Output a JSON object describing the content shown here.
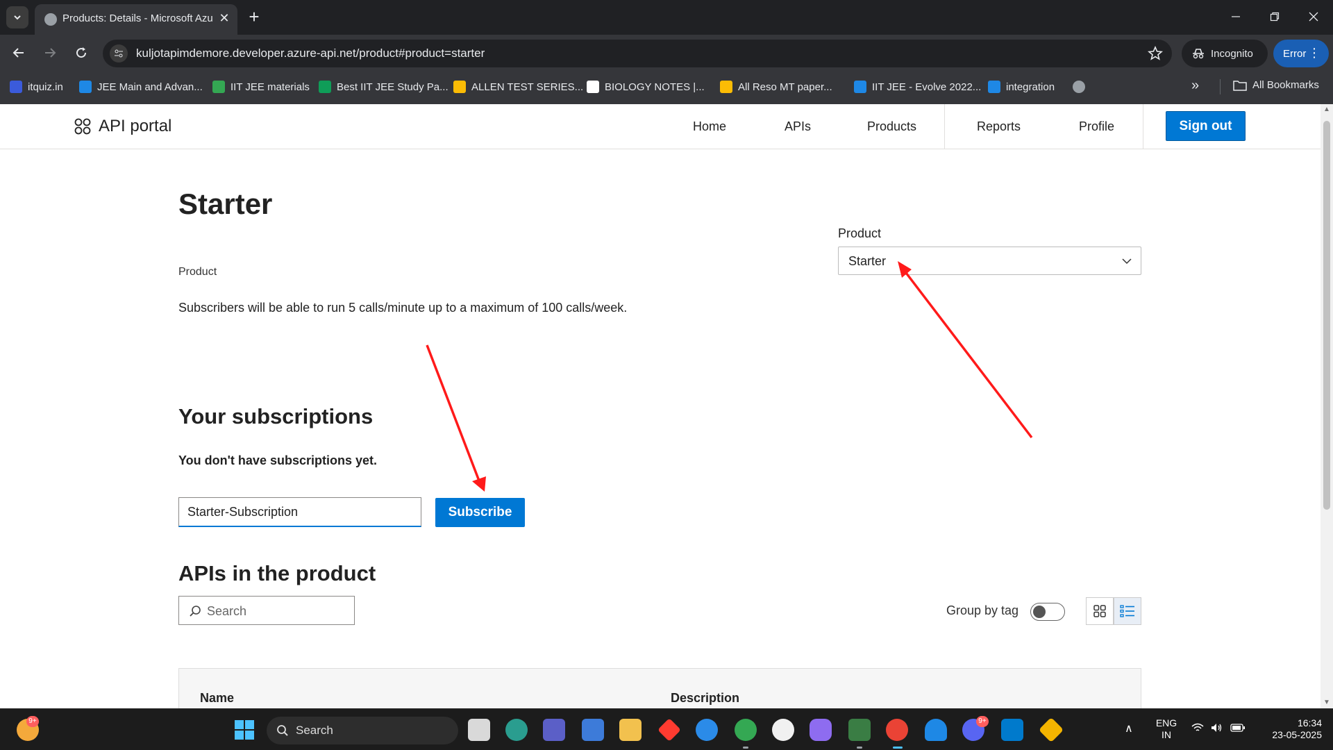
{
  "browser": {
    "tab_title": "Products: Details - Microsoft Azure",
    "url": "kuljotapimdemore.developer.azure-api.net/product#product=starter",
    "incognito_label": "Incognito",
    "error_label": "Error",
    "bookmarks": [
      {
        "label": "itquiz.in",
        "color": "#3b5bdb"
      },
      {
        "label": "JEE Main and Advan...",
        "color": "#1e88e5"
      },
      {
        "label": "IIT JEE materials",
        "color": "#34a853"
      },
      {
        "label": "Best IIT JEE Study Pa...",
        "color": "#0f9d58"
      },
      {
        "label": "ALLEN TEST SERIES...",
        "color": "#fbbc05"
      },
      {
        "label": "BIOLOGY NOTES |...",
        "color": "#ffffff"
      },
      {
        "label": "All Reso MT paper...",
        "color": "#fbbc05"
      },
      {
        "label": "IIT JEE - Evolve 2022...",
        "color": "#1e88e5"
      },
      {
        "label": "integration",
        "color": "#1e88e5"
      }
    ],
    "all_bookmarks_label": "All Bookmarks"
  },
  "portal": {
    "brand": "API portal",
    "nav": {
      "home": "Home",
      "apis": "APIs",
      "products": "Products",
      "reports": "Reports",
      "profile": "Profile",
      "signout": "Sign out"
    }
  },
  "product": {
    "title": "Starter",
    "type_label": "Product",
    "description": "Subscribers will be able to run 5 calls/minute up to a maximum of 100 calls/week.",
    "selector_label": "Product",
    "selector_value": "Starter"
  },
  "subscriptions": {
    "heading": "Your subscriptions",
    "empty_text": "You don't have subscriptions yet.",
    "input_value": "Starter-Subscription",
    "subscribe_label": "Subscribe"
  },
  "apis_section": {
    "heading": "APIs in the product",
    "search_placeholder": "Search",
    "group_by_tag_label": "Group by tag",
    "group_by_tag_on": false,
    "columns": [
      "Name",
      "Description"
    ]
  },
  "taskbar": {
    "search_label": "Search",
    "lang_line1": "ENG",
    "lang_line2": "IN",
    "time": "16:34",
    "date": "23-05-2025",
    "widget_badge": "9+",
    "discord_badge": "9+"
  },
  "colors": {
    "accent": "#0078d4",
    "annotation_arrow": "#ff0000"
  }
}
